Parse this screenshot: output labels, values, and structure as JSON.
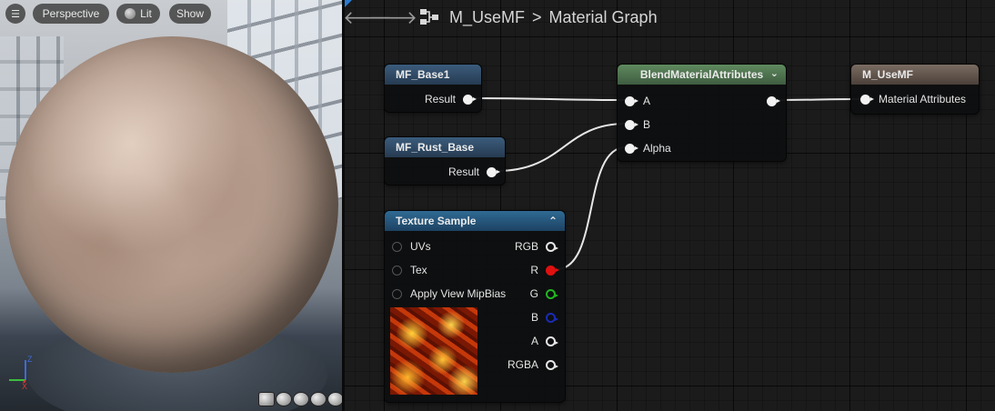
{
  "viewport": {
    "menu_icon": "hamburger-menu-icon",
    "perspective_label": "Perspective",
    "lit_label": "Lit",
    "show_label": "Show",
    "axis": {
      "z": "Z",
      "x": "X"
    },
    "preview_shapes": [
      "cylinder",
      "sphere",
      "plane",
      "cube",
      "custom-mesh"
    ]
  },
  "toolbar": {
    "back_icon": "arrow-left-icon",
    "forward_icon": "arrow-right-icon",
    "graph_icon": "material-graph-icon",
    "breadcrumb": {
      "material": "M_UseMF",
      "separator": ">",
      "graph": "Material Graph"
    }
  },
  "nodes": {
    "mf_base1": {
      "title": "MF_Base1",
      "output": "Result"
    },
    "mf_rust_base": {
      "title": "MF_Rust_Base",
      "output": "Result"
    },
    "blend": {
      "title": "BlendMaterialAttributes",
      "inputs": [
        "A",
        "B",
        "Alpha"
      ]
    },
    "result": {
      "title": "M_UseMF",
      "input": "Material Attributes"
    },
    "texture_sample": {
      "title": "Texture Sample",
      "inputs": [
        "UVs",
        "Tex",
        "Apply View MipBias"
      ],
      "outputs": [
        "RGB",
        "R",
        "G",
        "B",
        "A",
        "RGBA"
      ]
    }
  },
  "colors": {
    "graph_bg": "#1b1b1b",
    "function_header": "#3b5c7c",
    "blend_header": "#5f8a5f",
    "result_header": "#7a6c62",
    "texture_header": "#2f6a94",
    "pin_red": "#e01010",
    "pin_green": "#22b522",
    "pin_blue": "#1a2bb3"
  }
}
